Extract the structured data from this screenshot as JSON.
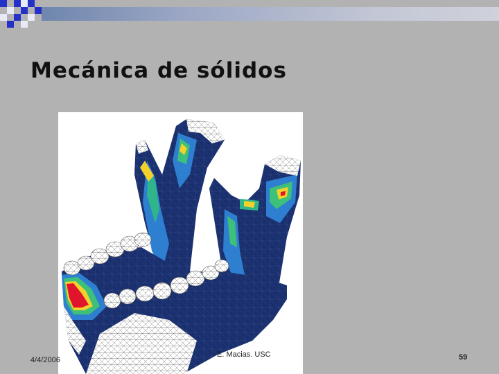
{
  "slide": {
    "title": "Mecánica de sólidos",
    "footer_date": "4/4/2006",
    "footer_author": "E. Macias. USC",
    "slide_number": "59"
  },
  "colors": {
    "background": "#b2b2b2",
    "accent_blue": "#2233cc",
    "mesh_dark_blue": "#142a66",
    "stress_red": "#e0142c"
  },
  "image": {
    "subject": "mandible-stress-finite-element-mesh"
  }
}
